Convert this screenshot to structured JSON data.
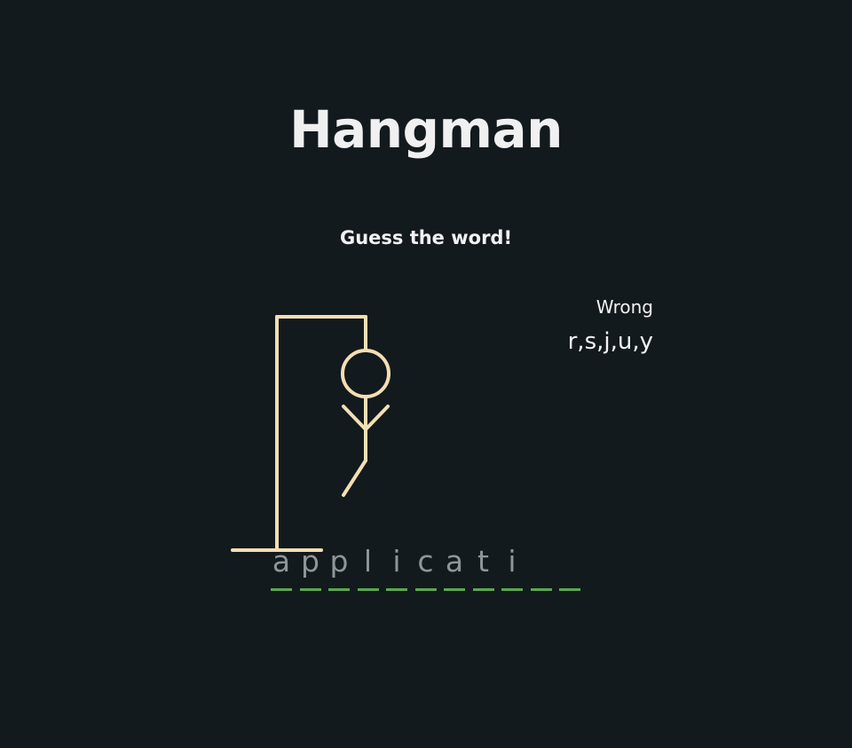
{
  "header": {
    "title": "Hangman",
    "subtitle": "Guess the word!"
  },
  "wrong": {
    "label": "Wrong",
    "letters": "r,s,j,u,y"
  },
  "word": {
    "slots": [
      "a",
      "p",
      "p",
      "l",
      "i",
      "c",
      "a",
      "t",
      "i",
      "",
      ""
    ]
  },
  "colors": {
    "background": "#121a1e",
    "figure": "#f5deb3",
    "underline": "#5aa84d",
    "revealed_letter": "#8f9699"
  }
}
